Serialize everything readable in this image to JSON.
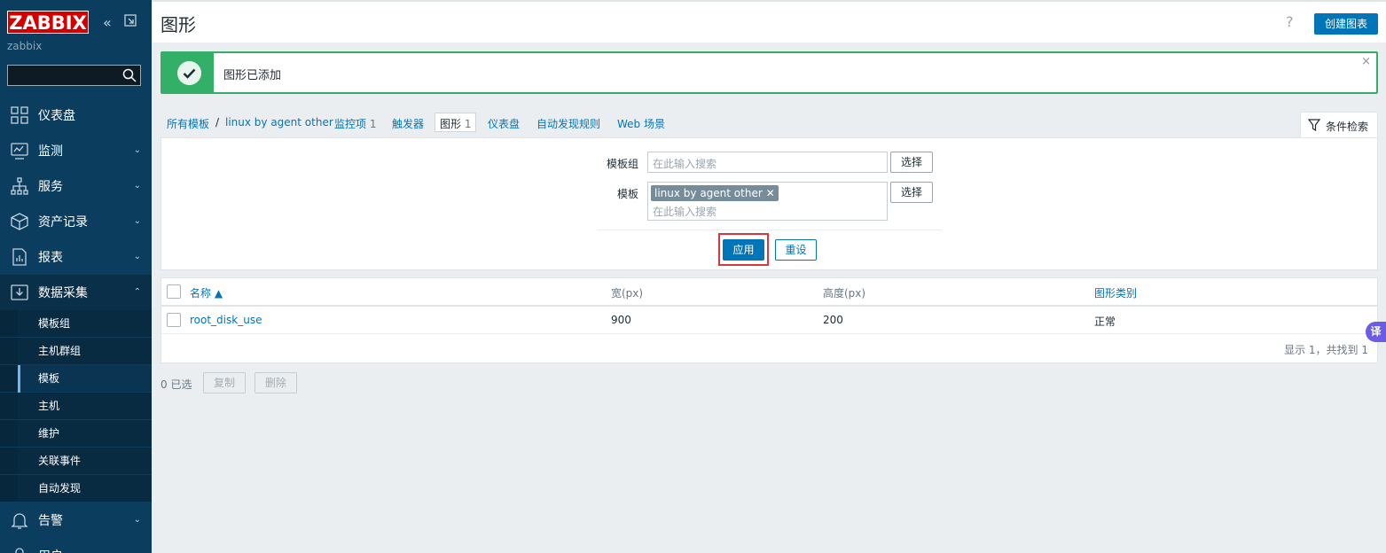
{
  "sidebar": {
    "logo": "ZABBIX",
    "instance": "zabbix",
    "menu": [
      {
        "label": "仪表盘"
      },
      {
        "label": "监测"
      },
      {
        "label": "服务"
      },
      {
        "label": "资产记录"
      },
      {
        "label": "报表"
      },
      {
        "label": "数据采集"
      },
      {
        "label": "告警"
      },
      {
        "label": "用户"
      }
    ],
    "submenu": [
      {
        "label": "模板组"
      },
      {
        "label": "主机群组"
      },
      {
        "label": "模板"
      },
      {
        "label": "主机"
      },
      {
        "label": "维护"
      },
      {
        "label": "关联事件"
      },
      {
        "label": "自动发现"
      }
    ]
  },
  "header": {
    "title": "图形",
    "help": "?",
    "create_button": "创建图表"
  },
  "message": {
    "text": "图形已添加",
    "close": "×"
  },
  "breadcrumbs": {
    "all_templates": "所有模板",
    "separator": "/",
    "template": "linux by agent other",
    "items": "监控项",
    "items_count": "1",
    "triggers": "触发器",
    "graphs": "图形",
    "graphs_count": "1",
    "dashboards": "仪表盘",
    "discovery": "自动发现规则",
    "web": "Web 场景",
    "filter_tab": "条件检索"
  },
  "filter": {
    "template_group_label": "模板组",
    "template_group_placeholder": "在此输入搜索",
    "select_label": "选择",
    "template_label": "模板",
    "template_tag": "linux by agent other",
    "template_placeholder": "在此输入搜索",
    "apply": "应用",
    "reset": "重设"
  },
  "table": {
    "headers": {
      "name": "名称 ▲",
      "width": "宽(px)",
      "height": "高度(px)",
      "type": "图形类别"
    },
    "rows": [
      {
        "name": "root_disk_use",
        "width": "900",
        "height": "200",
        "type": "正常"
      }
    ],
    "footer": "显示 1，共找到 1"
  },
  "mass": {
    "selected": "0 已选",
    "copy": "复制",
    "delete": "删除"
  },
  "translate": "译"
}
